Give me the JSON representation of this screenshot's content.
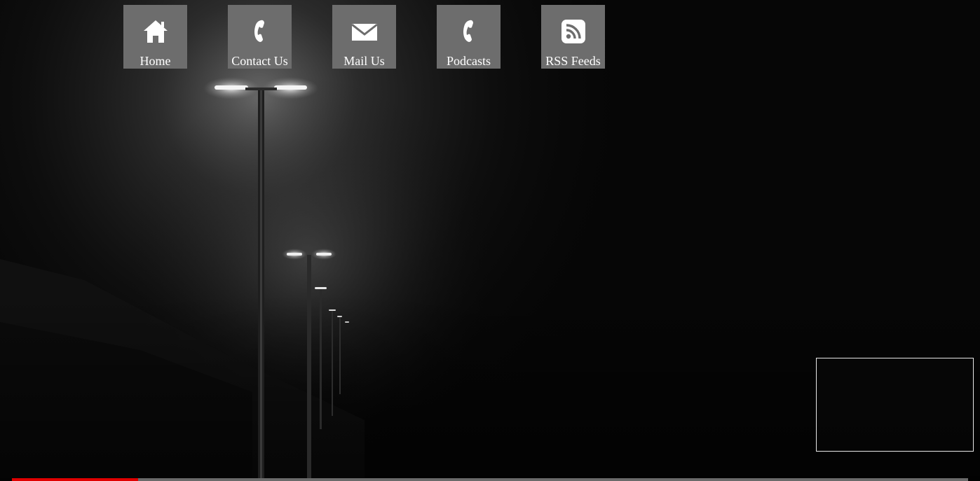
{
  "nav": {
    "items": [
      {
        "label": "Home",
        "icon": "home-icon"
      },
      {
        "label": "Contact Us",
        "icon": "phone-icon"
      },
      {
        "label": "Mail Us",
        "icon": "mail-icon"
      },
      {
        "label": "Podcasts",
        "icon": "phone-icon"
      },
      {
        "label": "RSS Feeds",
        "icon": "rss-icon"
      }
    ]
  },
  "video": {
    "progress_fraction": 0.132,
    "progress_color": "#e00000",
    "track_color": "#6a6a6a"
  },
  "colors": {
    "nav_tile": "#6d6d6d",
    "nav_text": "#ffffff",
    "background": "#060606"
  }
}
